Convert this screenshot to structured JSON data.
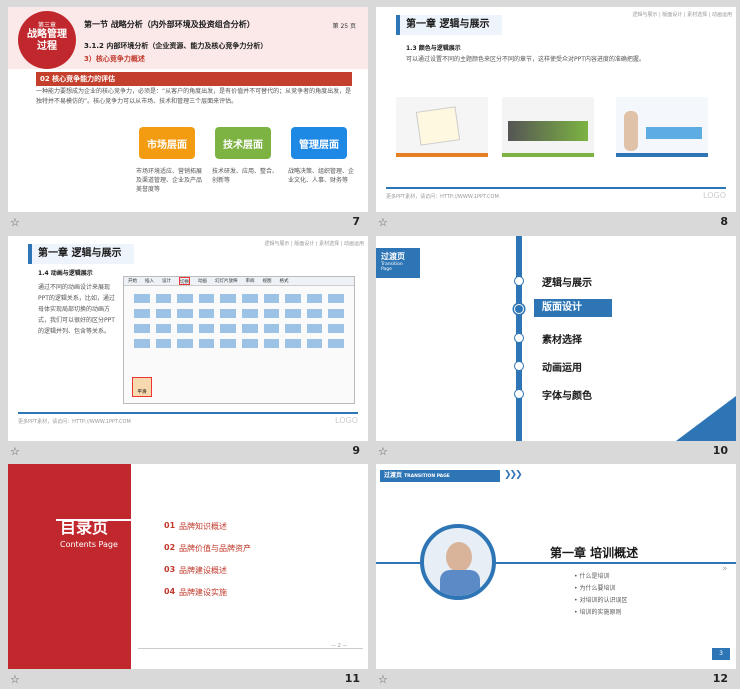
{
  "slides": [
    {
      "number": "7",
      "badge": "第三章 战略管理过程",
      "chapter_label": "第三章",
      "badge_title": "战略管理过程",
      "section_title": "第一节  战略分析（内外部环境及投资组合分析）",
      "page_label": "第 25 页",
      "subsection": "3.1.2 内部环境分析（企业资源、能力及核心竞争力分析）",
      "subsub": "3）核心竞争力概述",
      "bar_label": "02  核心竞争能力的评估",
      "body": "一种能力要想成为企业的核心竞争力，必须是：“从客户的角度出发，是有价值并不可替代的；从竞争者的角度出发，是独特并不易模仿的”。核心竞争力可以从市场、技术和管理三个层面来评估。",
      "boxes": [
        {
          "label": "市场层面",
          "color": "#f39c12",
          "desc": "市场环境适应、营销拓展及渠道管理、企业及产品美誉度等"
        },
        {
          "label": "技术层面",
          "color": "#7cb342",
          "desc": "技术研发、应用、整合、创新等"
        },
        {
          "label": "管理层面",
          "color": "#1e88e5",
          "desc": "战略决策、组织管理、企业文化、人事、财务等"
        }
      ]
    },
    {
      "number": "8",
      "chapter": "第一章  逻辑与展示",
      "heading": "1.3 颜色与逻辑展示",
      "body": "可以通过设置不同的主题颜色来区分不同的章节，这样使受众对PPT内容进度的准确把握。",
      "footer": "更多PPT素材，请访问：HTTP://WWW.1PPT.COM",
      "logo": "LOGO",
      "top_links": "逻辑与展示 | 版面设计 | 素材选择 | 动画运用"
    },
    {
      "number": "9",
      "chapter": "第一章  逻辑与展示",
      "heading": "1.4 动画与逻辑展示",
      "body": "通过不同的动画设计来展现PPT的逻辑关系，比如，通过母体实现局部切换的动画方式，我们可以很好的区分PPT的逻辑并列、包含等关系。",
      "footer": "更多PPT素材，请访问：HTTP://WWW.1PPT.COM",
      "logo": "LOGO",
      "menu": [
        "开始",
        "插入",
        "设计",
        "切换",
        "动画",
        "幻灯片放映",
        "审阅",
        "视图",
        "格式"
      ],
      "selected_menu": "切换",
      "selected_item": "平滑",
      "top_links": "逻辑与展示 | 版面设计 | 素材选择 | 动画运用"
    },
    {
      "number": "10",
      "chip": "过渡页",
      "chip_sub": "Transition Page",
      "items": [
        "逻辑与展示",
        "版面设计",
        "素材选择",
        "动画运用",
        "字体与颜色"
      ],
      "active": 1
    },
    {
      "number": "11",
      "title": "目录页",
      "subtitle": "Contents Page",
      "items": [
        {
          "n": "01",
          "t": "品牌知识概述"
        },
        {
          "n": "02",
          "t": "品牌价值与品牌资产"
        },
        {
          "n": "03",
          "t": "品牌建设概述"
        },
        {
          "n": "04",
          "t": "品牌建设实施"
        }
      ],
      "page_mark": "— 2 —"
    },
    {
      "number": "12",
      "chip": "过渡页",
      "chip_sub": "TRANSITION PAGE",
      "chapter": "第一章  培训概述",
      "items": [
        "什么是培训",
        "为什么要培训",
        "对培训的认识误区",
        "培训的实施原则"
      ],
      "page": "3"
    }
  ],
  "colors": {
    "accent_blue": "#2e75b6",
    "accent_red": "#c0282d",
    "selection": "#f2a14a"
  }
}
